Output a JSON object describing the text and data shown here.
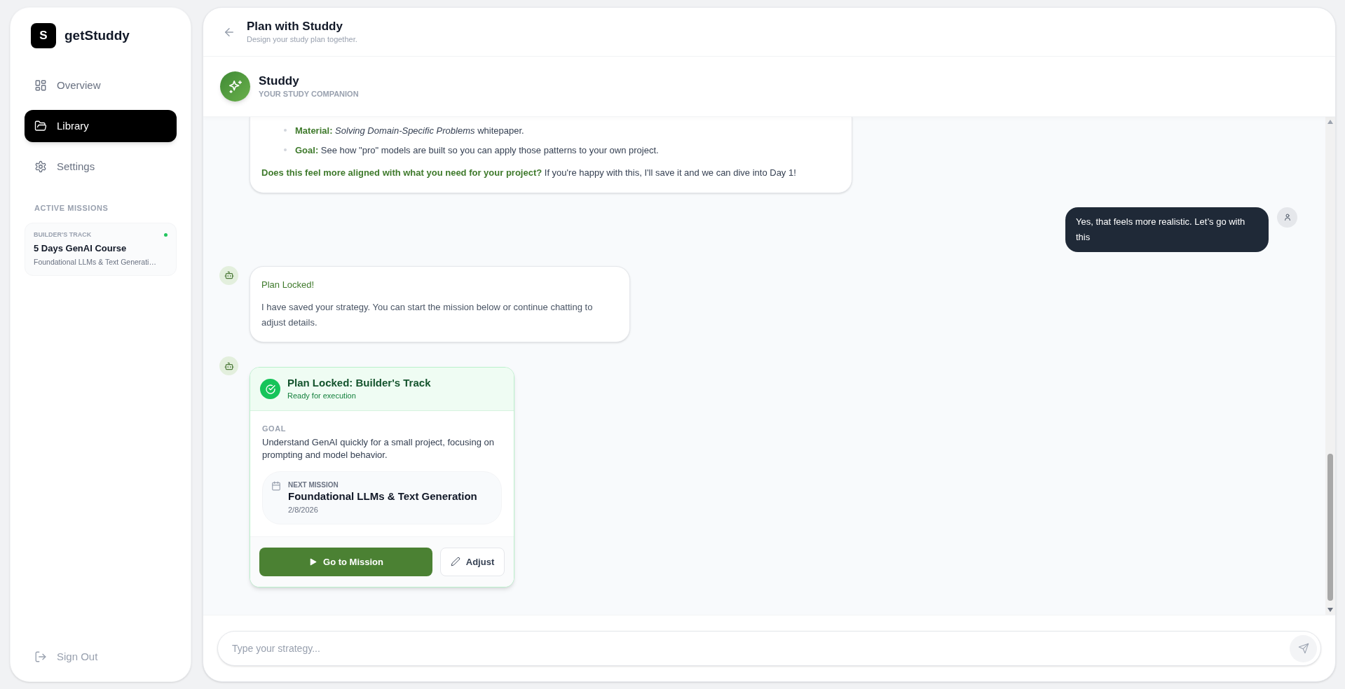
{
  "sidebar": {
    "logo_letter": "S",
    "brand": "getStuddy",
    "nav": [
      {
        "label": "Overview",
        "kind": "grid",
        "selected": false
      },
      {
        "label": "Library",
        "kind": "folder",
        "selected": true
      },
      {
        "label": "Settings",
        "kind": "gear",
        "selected": false
      }
    ],
    "section_title": "ACTIVE MISSIONS",
    "missions": [
      {
        "track": "BUILDER'S TRACK",
        "title": "5 Days GenAI Course",
        "subtitle": "Foundational LLMs & Text Generati…",
        "color": "#22c55e"
      }
    ],
    "sign_out": "Sign Out"
  },
  "header": {
    "title": "Plan with Studdy",
    "subtitle": "Design your study plan together."
  },
  "companion": {
    "name": "Studdy",
    "tagline": "YOUR STUDY COMPANION"
  },
  "messages": [
    {
      "kind": "bot_text",
      "bullets": [
        "**Material:** *Solving Domain-Specific Problems* whitepaper.",
        "**Goal:** See how \"pro\" models are built so you can apply those patterns to your own project."
      ],
      "closing": "**Does this feel more aligned with what you need for your project?** If you're happy with this, I'll save it and we can dive into Day 1!"
    },
    {
      "kind": "user",
      "text": "Yes, that feels more realistic. Let’s go with this"
    },
    {
      "kind": "bot_note",
      "title": "Plan Locked!",
      "body": "I have saved your strategy. You can start the mission below or continue chatting to adjust details."
    },
    {
      "kind": "plan_card",
      "title": "Plan Locked: Builder's Track",
      "status": "Ready for execution",
      "goal_label": "GOAL",
      "goal": "Understand GenAI quickly for a small project, focusing on prompting and model behavior.",
      "next_label": "NEXT MISSION",
      "next_title": "Foundational LLMs & Text Generation",
      "next_date": "2/8/2026",
      "primary": "Go to Mission",
      "secondary": "Adjust"
    }
  ],
  "composer": {
    "placeholder": "Type your strategy..."
  }
}
